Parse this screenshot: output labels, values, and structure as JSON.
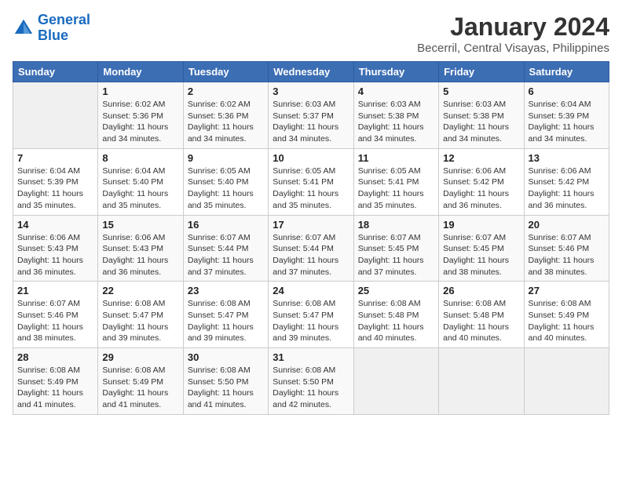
{
  "header": {
    "logo_line1": "General",
    "logo_line2": "Blue",
    "title": "January 2024",
    "location": "Becerril, Central Visayas, Philippines"
  },
  "days_of_week": [
    "Sunday",
    "Monday",
    "Tuesday",
    "Wednesday",
    "Thursday",
    "Friday",
    "Saturday"
  ],
  "weeks": [
    [
      {
        "num": "",
        "detail": ""
      },
      {
        "num": "1",
        "detail": "Sunrise: 6:02 AM\nSunset: 5:36 PM\nDaylight: 11 hours\nand 34 minutes."
      },
      {
        "num": "2",
        "detail": "Sunrise: 6:02 AM\nSunset: 5:36 PM\nDaylight: 11 hours\nand 34 minutes."
      },
      {
        "num": "3",
        "detail": "Sunrise: 6:03 AM\nSunset: 5:37 PM\nDaylight: 11 hours\nand 34 minutes."
      },
      {
        "num": "4",
        "detail": "Sunrise: 6:03 AM\nSunset: 5:38 PM\nDaylight: 11 hours\nand 34 minutes."
      },
      {
        "num": "5",
        "detail": "Sunrise: 6:03 AM\nSunset: 5:38 PM\nDaylight: 11 hours\nand 34 minutes."
      },
      {
        "num": "6",
        "detail": "Sunrise: 6:04 AM\nSunset: 5:39 PM\nDaylight: 11 hours\nand 34 minutes."
      }
    ],
    [
      {
        "num": "7",
        "detail": "Sunrise: 6:04 AM\nSunset: 5:39 PM\nDaylight: 11 hours\nand 35 minutes."
      },
      {
        "num": "8",
        "detail": "Sunrise: 6:04 AM\nSunset: 5:40 PM\nDaylight: 11 hours\nand 35 minutes."
      },
      {
        "num": "9",
        "detail": "Sunrise: 6:05 AM\nSunset: 5:40 PM\nDaylight: 11 hours\nand 35 minutes."
      },
      {
        "num": "10",
        "detail": "Sunrise: 6:05 AM\nSunset: 5:41 PM\nDaylight: 11 hours\nand 35 minutes."
      },
      {
        "num": "11",
        "detail": "Sunrise: 6:05 AM\nSunset: 5:41 PM\nDaylight: 11 hours\nand 35 minutes."
      },
      {
        "num": "12",
        "detail": "Sunrise: 6:06 AM\nSunset: 5:42 PM\nDaylight: 11 hours\nand 36 minutes."
      },
      {
        "num": "13",
        "detail": "Sunrise: 6:06 AM\nSunset: 5:42 PM\nDaylight: 11 hours\nand 36 minutes."
      }
    ],
    [
      {
        "num": "14",
        "detail": "Sunrise: 6:06 AM\nSunset: 5:43 PM\nDaylight: 11 hours\nand 36 minutes."
      },
      {
        "num": "15",
        "detail": "Sunrise: 6:06 AM\nSunset: 5:43 PM\nDaylight: 11 hours\nand 36 minutes."
      },
      {
        "num": "16",
        "detail": "Sunrise: 6:07 AM\nSunset: 5:44 PM\nDaylight: 11 hours\nand 37 minutes."
      },
      {
        "num": "17",
        "detail": "Sunrise: 6:07 AM\nSunset: 5:44 PM\nDaylight: 11 hours\nand 37 minutes."
      },
      {
        "num": "18",
        "detail": "Sunrise: 6:07 AM\nSunset: 5:45 PM\nDaylight: 11 hours\nand 37 minutes."
      },
      {
        "num": "19",
        "detail": "Sunrise: 6:07 AM\nSunset: 5:45 PM\nDaylight: 11 hours\nand 38 minutes."
      },
      {
        "num": "20",
        "detail": "Sunrise: 6:07 AM\nSunset: 5:46 PM\nDaylight: 11 hours\nand 38 minutes."
      }
    ],
    [
      {
        "num": "21",
        "detail": "Sunrise: 6:07 AM\nSunset: 5:46 PM\nDaylight: 11 hours\nand 38 minutes."
      },
      {
        "num": "22",
        "detail": "Sunrise: 6:08 AM\nSunset: 5:47 PM\nDaylight: 11 hours\nand 39 minutes."
      },
      {
        "num": "23",
        "detail": "Sunrise: 6:08 AM\nSunset: 5:47 PM\nDaylight: 11 hours\nand 39 minutes."
      },
      {
        "num": "24",
        "detail": "Sunrise: 6:08 AM\nSunset: 5:47 PM\nDaylight: 11 hours\nand 39 minutes."
      },
      {
        "num": "25",
        "detail": "Sunrise: 6:08 AM\nSunset: 5:48 PM\nDaylight: 11 hours\nand 40 minutes."
      },
      {
        "num": "26",
        "detail": "Sunrise: 6:08 AM\nSunset: 5:48 PM\nDaylight: 11 hours\nand 40 minutes."
      },
      {
        "num": "27",
        "detail": "Sunrise: 6:08 AM\nSunset: 5:49 PM\nDaylight: 11 hours\nand 40 minutes."
      }
    ],
    [
      {
        "num": "28",
        "detail": "Sunrise: 6:08 AM\nSunset: 5:49 PM\nDaylight: 11 hours\nand 41 minutes."
      },
      {
        "num": "29",
        "detail": "Sunrise: 6:08 AM\nSunset: 5:49 PM\nDaylight: 11 hours\nand 41 minutes."
      },
      {
        "num": "30",
        "detail": "Sunrise: 6:08 AM\nSunset: 5:50 PM\nDaylight: 11 hours\nand 41 minutes."
      },
      {
        "num": "31",
        "detail": "Sunrise: 6:08 AM\nSunset: 5:50 PM\nDaylight: 11 hours\nand 42 minutes."
      },
      {
        "num": "",
        "detail": ""
      },
      {
        "num": "",
        "detail": ""
      },
      {
        "num": "",
        "detail": ""
      }
    ]
  ]
}
